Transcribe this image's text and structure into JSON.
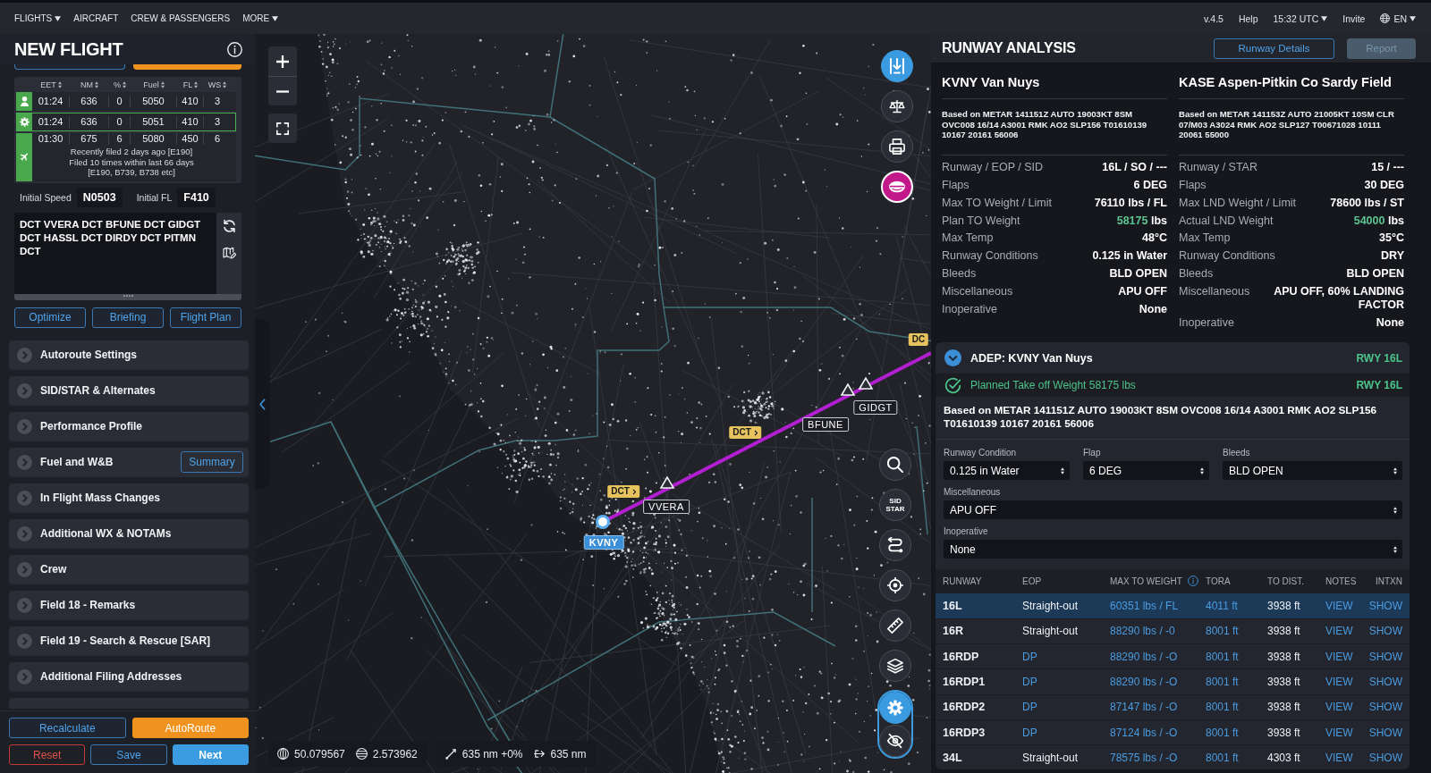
{
  "top_nav": {
    "menu": [
      {
        "label": "FLIGHTS",
        "dropdown": true
      },
      {
        "label": "AIRCRAFT",
        "dropdown": false
      },
      {
        "label": "CREW & PASSENGERS",
        "dropdown": false
      },
      {
        "label": "MORE",
        "dropdown": true
      }
    ],
    "status": [
      {
        "kind": "version",
        "label": "v.4.5"
      },
      {
        "kind": "link",
        "label": "Help"
      },
      {
        "kind": "dropdown",
        "label": "15:32 UTC"
      },
      {
        "kind": "link",
        "label": "Invite"
      },
      {
        "kind": "language",
        "label": "EN"
      }
    ]
  },
  "flight_panel": {
    "title": "NEW FLIGHT",
    "hidden_buttons": [
      {
        "kind": "secondary"
      },
      {
        "kind": "warning"
      }
    ],
    "route_options": {
      "columns": [
        "EET",
        "NM",
        "%",
        "Fuel",
        "FL",
        "WS"
      ],
      "rows": [
        {
          "kind": "user",
          "selected": false,
          "cells": [
            "01:24",
            "636",
            "0",
            "5050",
            "410",
            "3"
          ]
        },
        {
          "kind": "optimized",
          "selected": true,
          "cells": [
            "01:24",
            "636",
            "0",
            "5051",
            "410",
            "3"
          ]
        },
        {
          "kind": "filed",
          "selected": false,
          "cells": [
            "01:30",
            "675",
            "6",
            "5080",
            "450",
            "6"
          ],
          "notes": [
            "Recently filed 2 days ago [E190]",
            "Filed 10 times within last 66 days",
            "[E190, B739, B738 etc]"
          ]
        }
      ]
    },
    "initial_speed": {
      "label": "Initial Speed",
      "value": "N0503"
    },
    "initial_fl": {
      "label": "Initial FL",
      "value": "F410"
    },
    "route": "DCT VVERA DCT BFUNE DCT GIDGT DCT HASSL DCT DIRDY DCT PITMN DCT",
    "actions": [
      "Optimize",
      "Briefing",
      "Flight Plan"
    ],
    "sections": [
      {
        "label": "Autoroute Settings"
      },
      {
        "label": "SID/STAR & Alternates"
      },
      {
        "label": "Performance Profile"
      },
      {
        "label": "Fuel and W&B",
        "button": "Summary"
      },
      {
        "label": "In Flight Mass Changes"
      },
      {
        "label": "Additional WX & NOTAMs"
      },
      {
        "label": "Crew"
      },
      {
        "label": "Field 18 - Remarks"
      },
      {
        "label": "Field 19 - Search & Rescue [SAR]"
      },
      {
        "label": "Additional Filing Addresses"
      }
    ],
    "more_sections_below": true,
    "footer_buttons": [
      {
        "label": "Recalculate",
        "kind": "secondary"
      },
      {
        "label": "AutoRoute",
        "kind": "warning"
      },
      {
        "label": "Reset",
        "kind": "danger"
      },
      {
        "label": "Save",
        "kind": "secondary"
      },
      {
        "label": "Next",
        "kind": "primary"
      }
    ]
  },
  "map": {
    "tools_top": [
      {
        "active": true,
        "alert": false
      },
      {
        "active": false,
        "alert": false
      },
      {
        "active": false,
        "alert": false
      },
      {
        "active": false,
        "alert": true
      }
    ],
    "tools_bottom": [
      {
        "active": false
      },
      {
        "active": false,
        "label": "SID STAR"
      },
      {
        "active": false
      },
      {
        "active": false
      },
      {
        "active": false
      },
      {
        "active": false
      },
      {
        "active": true
      },
      {
        "active": false
      }
    ],
    "route_points": [
      {
        "name": "KVNY",
        "kind": "airport"
      },
      {
        "name": "VVERA",
        "kind": "waypoint"
      },
      {
        "name": "BFUNE",
        "kind": "waypoint"
      },
      {
        "name": "GIDGT",
        "kind": "waypoint"
      }
    ],
    "legs": [
      {
        "label": "DCT",
        "truncated": false
      },
      {
        "label": "DCT",
        "truncated": false
      },
      {
        "label": "DC",
        "truncated": true
      }
    ],
    "position": {
      "latitude": "50.079567",
      "longitude": "2.573962"
    },
    "measure": {
      "distance": "635 nm +0%",
      "route": "635 nm"
    }
  },
  "runway_analysis": {
    "title": "RUNWAY ANALYSIS",
    "buttons": [
      {
        "label": "Runway Details",
        "disabled": false
      },
      {
        "label": "Report",
        "disabled": true
      }
    ],
    "airports": [
      {
        "title": "KVNY Van Nuys",
        "metar": "Based on METAR 141151Z AUTO 19003KT 8SM OVC008 16/14 A3001 RMK AO2 SLP156 T01610139 10167 20161 56006",
        "rows": [
          {
            "label": "Runway / EOP / SID",
            "value": "16L / SO / ---"
          },
          {
            "label": "Flaps",
            "value": "6 DEG"
          },
          {
            "label": "Max TO Weight / Limit",
            "value": "76110 lbs / FL"
          },
          {
            "label": "Plan TO Weight",
            "value": "58175",
            "unit": "lbs",
            "ok": true
          },
          {
            "label": "Max Temp",
            "value": "48°C"
          },
          {
            "label": "Runway Conditions",
            "value": "0.125 in Water"
          },
          {
            "label": "Bleeds",
            "value": "BLD OPEN"
          },
          {
            "label": "Miscellaneous",
            "value": "APU OFF"
          },
          {
            "label": "Inoperative",
            "value": "None"
          }
        ]
      },
      {
        "title": "KASE Aspen-Pitkin Co Sardy Field",
        "metar": "Based on METAR 141153Z AUTO 21005KT 10SM CLR 07/M03 A3024 RMK AO2 SLP127 T00671028 10111 20061 55000",
        "rows": [
          {
            "label": "Runway / STAR",
            "value": "15 / ---"
          },
          {
            "label": "Flaps",
            "value": "30 DEG"
          },
          {
            "label": "Max LND Weight / Limit",
            "value": "78600 lbs / ST"
          },
          {
            "label": "Actual LND Weight",
            "value": "54000",
            "unit": "lbs",
            "ok": true
          },
          {
            "label": "Max Temp",
            "value": "35°C"
          },
          {
            "label": "Runway Conditions",
            "value": "DRY"
          },
          {
            "label": "Bleeds",
            "value": "BLD OPEN"
          },
          {
            "label": "Miscellaneous",
            "value": "APU OFF, 60% LANDING FACTOR"
          },
          {
            "label": "Inoperative",
            "value": "None"
          }
        ]
      }
    ],
    "departure": {
      "title": "ADEP: KVNY Van Nuys",
      "runway": "RWY 16L",
      "expanded": true,
      "check": {
        "text": "Planned Take off Weight 58175 lbs",
        "runway": "RWY 16L",
        "ok": true
      },
      "metar": "Based on METAR 141151Z AUTO 19003KT 8SM OVC008 16/14 A3001 RMK AO2 SLP156 T01610139 10167 20161 56006",
      "settings": [
        {
          "label": "Runway Condition",
          "value": "0.125 in Water"
        },
        {
          "label": "Flap",
          "value": "6 DEG"
        },
        {
          "label": "Bleeds",
          "value": "BLD OPEN"
        },
        {
          "label": "Miscellaneous",
          "value": "APU OFF"
        },
        {
          "label": "Inoperative",
          "value": "None"
        }
      ],
      "table": {
        "columns": [
          {
            "label": "RUNWAY"
          },
          {
            "label": "EOP"
          },
          {
            "label": "MAX TO WEIGHT",
            "info": true
          },
          {
            "label": "TORA"
          },
          {
            "label": "TO DIST."
          },
          {
            "label": "NOTES"
          },
          {
            "label": "INTXN"
          }
        ],
        "rows": [
          {
            "selected": true,
            "eop_link": false,
            "cells": [
              "16L",
              "Straight-out",
              "60351 lbs / FL",
              "4011 ft",
              "3938 ft",
              "VIEW",
              "SHOW"
            ]
          },
          {
            "selected": false,
            "eop_link": false,
            "cells": [
              "16R",
              "Straight-out",
              "88290 lbs / -0",
              "8001 ft",
              "3938 ft",
              "VIEW",
              "SHOW"
            ]
          },
          {
            "selected": false,
            "eop_link": true,
            "cells": [
              "16RDP",
              "DP",
              "88290 lbs / -O",
              "8001 ft",
              "3938 ft",
              "VIEW",
              "SHOW"
            ]
          },
          {
            "selected": false,
            "eop_link": true,
            "cells": [
              "16RDP1",
              "DP",
              "88290 lbs / -O",
              "8001 ft",
              "3938 ft",
              "VIEW",
              "SHOW"
            ]
          },
          {
            "selected": false,
            "eop_link": true,
            "cells": [
              "16RDP2",
              "DP",
              "87147 lbs / -O",
              "8001 ft",
              "3938 ft",
              "VIEW",
              "SHOW"
            ]
          },
          {
            "selected": false,
            "eop_link": true,
            "cells": [
              "16RDP3",
              "DP",
              "87124 lbs / -O",
              "8001 ft",
              "3938 ft",
              "VIEW",
              "SHOW"
            ]
          },
          {
            "selected": false,
            "eop_link": false,
            "cells": [
              "34L",
              "Straight-out",
              "78575 lbs / -O",
              "8001 ft",
              "4303 ft",
              "VIEW",
              "SHOW"
            ]
          }
        ]
      }
    }
  }
}
